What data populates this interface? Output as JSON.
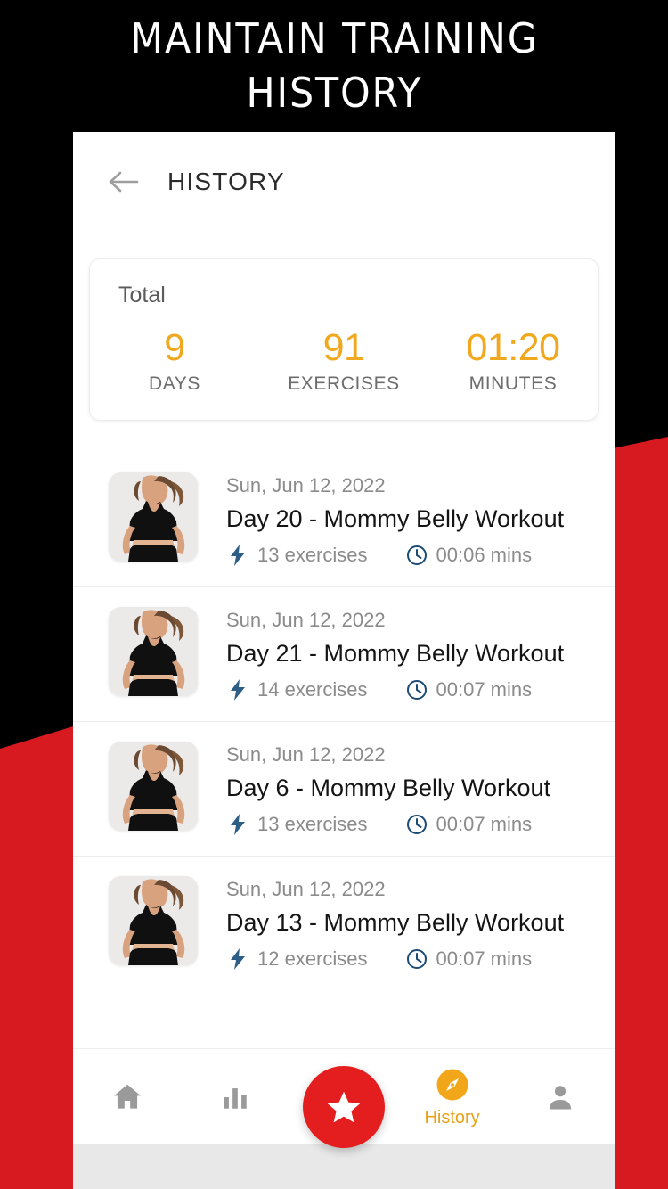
{
  "promo": {
    "line1": "Maintain Training",
    "line2": "History",
    "text_color": "#ffffff",
    "background_color": "#000000",
    "accent_red": "#D71920"
  },
  "app_bar": {
    "back_icon": "arrow-left-icon",
    "title": "HISTORY"
  },
  "total_card": {
    "label": "Total",
    "accent_color": "#F0A81E",
    "stats": [
      {
        "value": "9",
        "label": "DAYS"
      },
      {
        "value": "91",
        "label": "EXERCISES"
      },
      {
        "value": "01:20",
        "label": "MINUTES"
      }
    ]
  },
  "history": {
    "items": [
      {
        "date": "Sun, Jun 12, 2022",
        "title": "Day 20 - Mommy Belly Workout",
        "exercises": "13 exercises",
        "duration": "00:06 mins",
        "exercises_icon": "bolt-icon",
        "duration_icon": "clock-icon",
        "thumbnail": "woman-workout-thumbnail"
      },
      {
        "date": "Sun, Jun 12, 2022",
        "title": "Day 21 - Mommy Belly Workout",
        "exercises": "14 exercises",
        "duration": "00:07 mins",
        "exercises_icon": "bolt-icon",
        "duration_icon": "clock-icon",
        "thumbnail": "woman-workout-thumbnail"
      },
      {
        "date": "Sun, Jun 12, 2022",
        "title": "Day 6 - Mommy Belly Workout",
        "exercises": "13 exercises",
        "duration": "00:07 mins",
        "exercises_icon": "bolt-icon",
        "duration_icon": "clock-icon",
        "thumbnail": "woman-workout-thumbnail"
      },
      {
        "date": "Sun, Jun 12, 2022",
        "title": "Day 13 - Mommy Belly Workout",
        "exercises": "12 exercises",
        "duration": "00:07 mins",
        "exercises_icon": "bolt-icon",
        "duration_icon": "clock-icon",
        "thumbnail": "woman-workout-thumbnail"
      }
    ]
  },
  "bottom_nav": {
    "active_color": "#E8A317",
    "inactive_color": "#9a9a9a",
    "fab": {
      "icon": "star-icon",
      "color": "#E41E1E"
    },
    "items": [
      {
        "icon": "home-icon",
        "label": "",
        "active": false
      },
      {
        "icon": "bar-chart-icon",
        "label": "",
        "active": false
      },
      {
        "icon": "compass-icon",
        "label": "History",
        "active": true
      },
      {
        "icon": "person-icon",
        "label": "",
        "active": false
      }
    ]
  }
}
